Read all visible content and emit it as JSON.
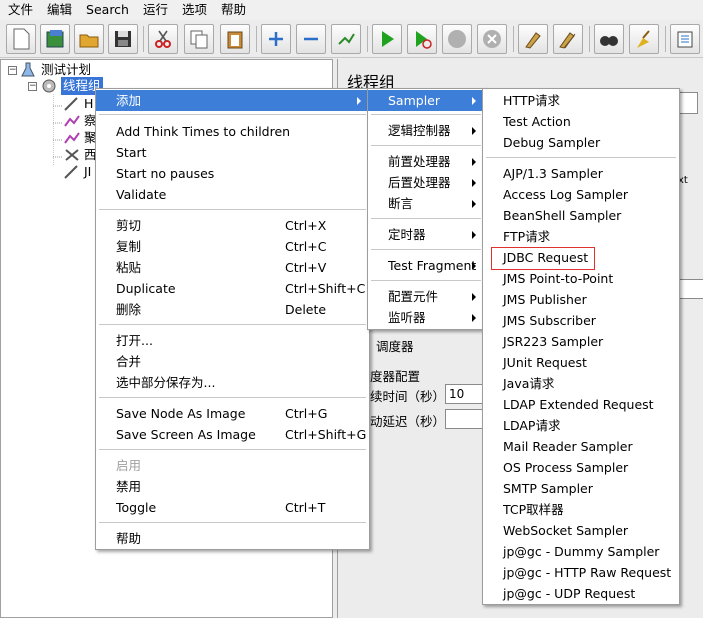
{
  "menubar": [
    "文件",
    "编辑",
    "Search",
    "运行",
    "选项",
    "帮助"
  ],
  "toolbar": {
    "icons": [
      "new-icon",
      "templates-icon",
      "open-icon",
      "save-icon",
      "cut-icon",
      "copy-icon",
      "paste-icon",
      "expand-icon",
      "collapse-icon",
      "toggle-icon",
      "start-icon",
      "start-no-pauses-icon",
      "stop-icon",
      "shutdown-icon",
      "clear-icon",
      "clear-all-icon",
      "search-icon",
      "reset-search-icon",
      "function-helper-icon"
    ]
  },
  "tree": {
    "root_label": "测试计划",
    "thread_group_label": "线程组",
    "child_labels": [
      "H",
      "察",
      "聚",
      "西",
      "JI"
    ]
  },
  "right_panel": {
    "title": "线程组",
    "fragment_text": "xt",
    "scheduler_label": "调度器",
    "scheduler_config_label": "度器配置",
    "duration_label": "续时间（秒）",
    "duration_value": "10",
    "startup_delay_label": "动延迟（秒）"
  },
  "context_menu": {
    "items": [
      {
        "label": "添加",
        "shortcut": "",
        "submenu": true,
        "highlighted": true
      },
      {
        "label": "Add Think Times to children",
        "shortcut": ""
      },
      {
        "label": "Start",
        "shortcut": ""
      },
      {
        "label": "Start no pauses",
        "shortcut": ""
      },
      {
        "label": "Validate",
        "shortcut": ""
      },
      {
        "label": "剪切",
        "shortcut": "Ctrl+X"
      },
      {
        "label": "复制",
        "shortcut": "Ctrl+C"
      },
      {
        "label": "粘贴",
        "shortcut": "Ctrl+V"
      },
      {
        "label": "Duplicate",
        "shortcut": "Ctrl+Shift+C"
      },
      {
        "label": "删除",
        "shortcut": "Delete"
      },
      {
        "label": "打开...",
        "shortcut": ""
      },
      {
        "label": "合并",
        "shortcut": ""
      },
      {
        "label": "选中部分保存为...",
        "shortcut": ""
      },
      {
        "label": "Save Node As Image",
        "shortcut": "Ctrl+G"
      },
      {
        "label": "Save Screen As Image",
        "shortcut": "Ctrl+Shift+G"
      },
      {
        "label": "启用",
        "shortcut": "",
        "disabled": true
      },
      {
        "label": "禁用",
        "shortcut": ""
      },
      {
        "label": "Toggle",
        "shortcut": "Ctrl+T"
      },
      {
        "label": "帮助",
        "shortcut": ""
      }
    ]
  },
  "add_submenu": {
    "items": [
      {
        "label": "Sampler",
        "highlighted": true
      },
      {
        "label": "逻辑控制器"
      },
      {
        "label": "前置处理器"
      },
      {
        "label": "后置处理器"
      },
      {
        "label": "断言"
      },
      {
        "label": "定时器"
      },
      {
        "label": "Test Fragment"
      },
      {
        "label": "配置元件"
      },
      {
        "label": "监听器"
      }
    ]
  },
  "sampler_submenu": {
    "items": [
      "HTTP请求",
      "Test Action",
      "Debug Sampler",
      "AJP/1.3 Sampler",
      "Access Log Sampler",
      "BeanShell Sampler",
      "FTP请求",
      "JDBC Request",
      "JMS Point-to-Point",
      "JMS Publisher",
      "JMS Subscriber",
      "JSR223 Sampler",
      "JUnit Request",
      "Java请求",
      "LDAP Extended Request",
      "LDAP请求",
      "Mail Reader Sampler",
      "OS Process Sampler",
      "SMTP Sampler",
      "TCP取样器",
      "WebSocket Sampler",
      "jp@gc - Dummy Sampler",
      "jp@gc - HTTP Raw Request",
      "jp@gc - UDP Request"
    ],
    "boxed_item": "JDBC Request"
  },
  "colors": {
    "highlight": "#3d7fd8",
    "selection": "#3875d7",
    "box": "#e03030"
  }
}
